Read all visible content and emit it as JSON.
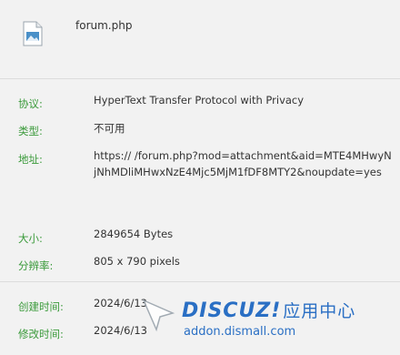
{
  "file": {
    "icon": "image-file-icon",
    "name": "forum.php"
  },
  "details": [
    {
      "label": "协议:",
      "value": "HyperText Transfer Protocol with Privacy"
    },
    {
      "label": "类型:",
      "value": "不可用"
    },
    {
      "label": "地址:",
      "value": "https://                    /forum.php?mod=attachment&aid=MTE4MHwyNjNhMDliMHwxNzE4Mjc5MjM1fDF8MTY2&noupdate=yes"
    }
  ],
  "sizes": [
    {
      "label": "大小:",
      "value": "2849654 Bytes"
    },
    {
      "label": "分辨率:",
      "value": "805 x 790 pixels"
    }
  ],
  "dates": [
    {
      "label": "创建时间:",
      "value": "2024/6/13"
    },
    {
      "label": "修改时间:",
      "value": "2024/6/13"
    }
  ],
  "watermark": {
    "logo": "DISCUZ!",
    "logo_cn": "应用中心",
    "url": "addon.dismall.com"
  },
  "colors": {
    "label": "#3a9a3a",
    "brand": "#2a6fc4"
  }
}
